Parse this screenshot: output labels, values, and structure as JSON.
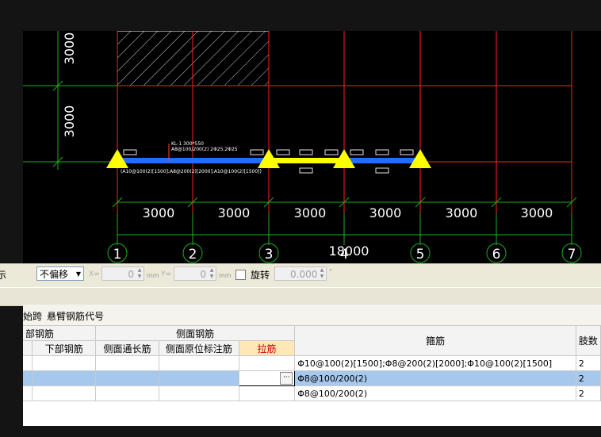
{
  "drawing": {
    "dims_vertical": [
      "3000",
      "3000"
    ],
    "dims_horizontal": [
      "3000",
      "3000",
      "3000",
      "3000",
      "3000",
      "3000"
    ],
    "total_dim": "18000",
    "axis_labels": [
      "1",
      "2",
      "3",
      "4",
      "5",
      "6",
      "7"
    ],
    "beam_label_1": "KL-1 300*550",
    "beam_label_2": "A8@100/200(2) 2Φ25;2Φ25",
    "beam_bottom_note": "(A10@100(2)[1500];A8@200(2)[2000];A10@100(2)[1500])",
    "colors": {
      "grid_red": "#ff2020",
      "dim_green": "#1fae1f",
      "beam_blue": "#1f6fff",
      "beam_yellow": "#ffff00",
      "support_yellow": "#ffff00"
    }
  },
  "toolbar": {
    "cut_label": "示",
    "offset_value": "不偏移",
    "x_label": "X=",
    "x_value": "0",
    "y_label": "Y=",
    "y_value": "0",
    "unit": "mm",
    "rotate_label": "旋转",
    "rotate_value": "0.000",
    "degree": "°"
  },
  "tabs": {
    "tab1": "始跨",
    "tab2": "悬臂钢筋代号"
  },
  "table": {
    "group_bottom": "部钢筋",
    "group_side": "侧面钢筋",
    "col_bottom": "下部钢筋",
    "col_side_long": "侧面通长筋",
    "col_side_mark": "侧面原位标注筋",
    "col_tie": "拉筋",
    "col_stirrup": "箍筋",
    "col_legs": "肢数",
    "rows": [
      {
        "stirrup": "Φ10@100(2)[1500];Φ8@200(2)[2000];Φ10@100(2)[1500]",
        "legs": "2"
      },
      {
        "stirrup": "Φ8@100/200(2)",
        "legs": "2"
      },
      {
        "stirrup": "Φ8@100/200(2)",
        "legs": "2"
      }
    ],
    "ellipsis": "···"
  }
}
